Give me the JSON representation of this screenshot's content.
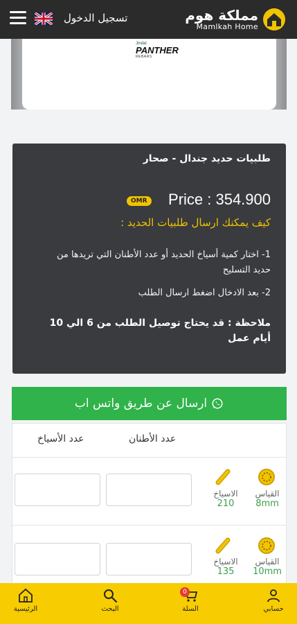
{
  "header": {
    "login_label": "تسجيل الدخول",
    "logo_ar": "مملكة هوم",
    "logo_en": "Mamlkah Home"
  },
  "hero": {
    "brand_small": "Jindal",
    "brand_name": "PANTHER",
    "brand_sub": "REBARS"
  },
  "info": {
    "title": "طلبيات حديد جندال - صحار",
    "price": "Price : 354.900",
    "currency": "OMR",
    "how_title": "كيف يمكنك ارسال طلبيات الحديد :",
    "step1": "1- اختار كمية أسياخ الحديد أو عدد الأطنان التي تريدها من حديد التسليح",
    "step2": "2- بعد الادخال اضغط ارسال الطلب",
    "note": "ملاحظة : قد يحتاج توصيل الطلب من 6 الي 10 أيام عمل"
  },
  "whatsapp": {
    "label": "ارسال عن طريق واتس اب"
  },
  "table": {
    "col_tons": "عدد الأطنان",
    "col_bars": "عدد الأسياخ",
    "rows": [
      {
        "size_label": "القياس",
        "size_value": "8mm",
        "bars_label": "الاسياخ",
        "bars_value": "210"
      },
      {
        "size_label": "القياس",
        "size_value": "10mm",
        "bars_label": "الاسياخ",
        "bars_value": "135"
      }
    ]
  },
  "bottom_nav": {
    "account": "حسابي",
    "cart": "السلة",
    "cart_count": "0",
    "search": "البحث",
    "home": "الرئيسية"
  },
  "colors": {
    "accent": "#f7cc00",
    "whatsapp": "#2fb34a",
    "card": "#393b3e",
    "header": "#2b2b2b"
  }
}
